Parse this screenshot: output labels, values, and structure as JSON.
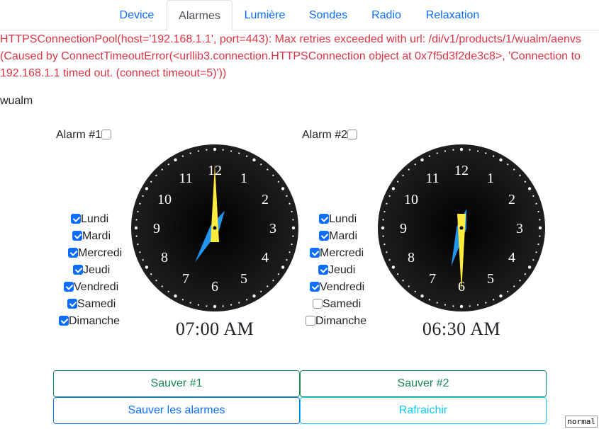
{
  "tabs": [
    {
      "label": "Device"
    },
    {
      "label": "Alarmes"
    },
    {
      "label": "Lumière"
    },
    {
      "label": "Sondes"
    },
    {
      "label": "Radio"
    },
    {
      "label": "Relaxation"
    }
  ],
  "active_tab": "Alarmes",
  "error_message": "HTTPSConnectionPool(host='192.168.1.1', port=443): Max retries exceeded with url: /di/v1/products/1/wualm/aenvs (Caused by ConnectTimeoutError(<urllib3.connection.HTTPSConnection object at 0x7f5d3f2de3c8>, 'Connection to 192.168.1.1 timed out. (connect timeout=5)'))",
  "device_id": "wualm",
  "alarms": [
    {
      "label": "Alarm #1",
      "enabled": false,
      "time": "07:00 AM",
      "hour": 7,
      "minute": 0,
      "days": [
        {
          "label": "Lundi",
          "checked": true
        },
        {
          "label": "Mardi",
          "checked": true
        },
        {
          "label": "Mercredi",
          "checked": true
        },
        {
          "label": "Jeudi",
          "checked": true
        },
        {
          "label": "Vendredi",
          "checked": true
        },
        {
          "label": "Samedi",
          "checked": true
        },
        {
          "label": "Dimanche",
          "checked": true
        }
      ]
    },
    {
      "label": "Alarm #2",
      "enabled": false,
      "time": "06:30 AM",
      "hour": 6,
      "minute": 30,
      "days": [
        {
          "label": "Lundi",
          "checked": true
        },
        {
          "label": "Mardi",
          "checked": true
        },
        {
          "label": "Mercredi",
          "checked": true
        },
        {
          "label": "Jeudi",
          "checked": true
        },
        {
          "label": "Vendredi",
          "checked": true
        },
        {
          "label": "Samedi",
          "checked": false
        },
        {
          "label": "Dimanche",
          "checked": false
        }
      ]
    }
  ],
  "clock_numbers": [
    "12",
    "1",
    "2",
    "3",
    "4",
    "5",
    "6",
    "7",
    "8",
    "9",
    "10",
    "11"
  ],
  "buttons": {
    "save1": "Sauver #1",
    "save2": "Sauver #2",
    "save_all": "Sauver les alarmes",
    "refresh": "Rafraichir"
  },
  "mode_badge": "normal",
  "colors": {
    "hour_hand": "#2196f3",
    "minute_hand": "#ffeb3b",
    "clock_face": "#000000"
  }
}
